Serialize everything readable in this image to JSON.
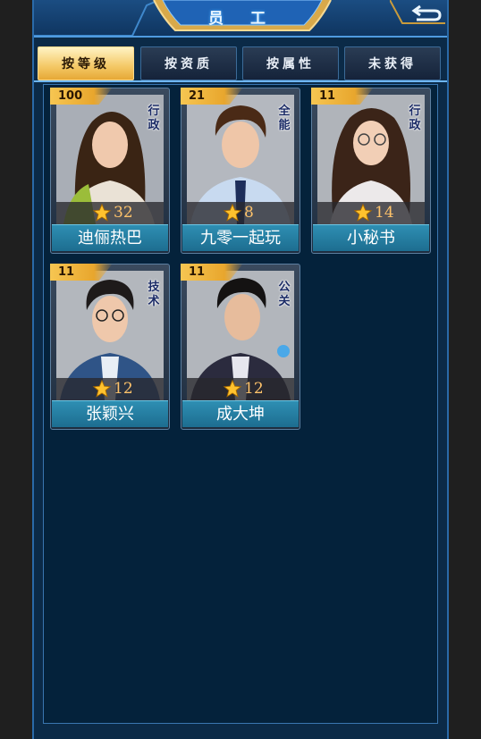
{
  "header": {
    "title": "员 工",
    "back_icon": "return-arrow-icon"
  },
  "tabs": [
    {
      "label": "按等级",
      "active": true
    },
    {
      "label": "按资质",
      "active": false
    },
    {
      "label": "按属性",
      "active": false
    },
    {
      "label": "未获得",
      "active": false
    }
  ],
  "employees": [
    {
      "name": "迪俪热巴",
      "level": "100",
      "role": "行政",
      "stars": "32"
    },
    {
      "name": "九零一起玩",
      "level": "21",
      "role": "全能",
      "stars": "8"
    },
    {
      "name": "小秘书",
      "level": "11",
      "role": "行政",
      "stars": "14"
    },
    {
      "name": "张颖兴",
      "level": "11",
      "role": "技术",
      "stars": "12"
    },
    {
      "name": "成大坤",
      "level": "11",
      "role": "公关",
      "stars": "12"
    }
  ],
  "colors": {
    "accent_gold": "#f4c865",
    "panel_bg": "#04223b",
    "name_bar": "#2e8fb3"
  }
}
